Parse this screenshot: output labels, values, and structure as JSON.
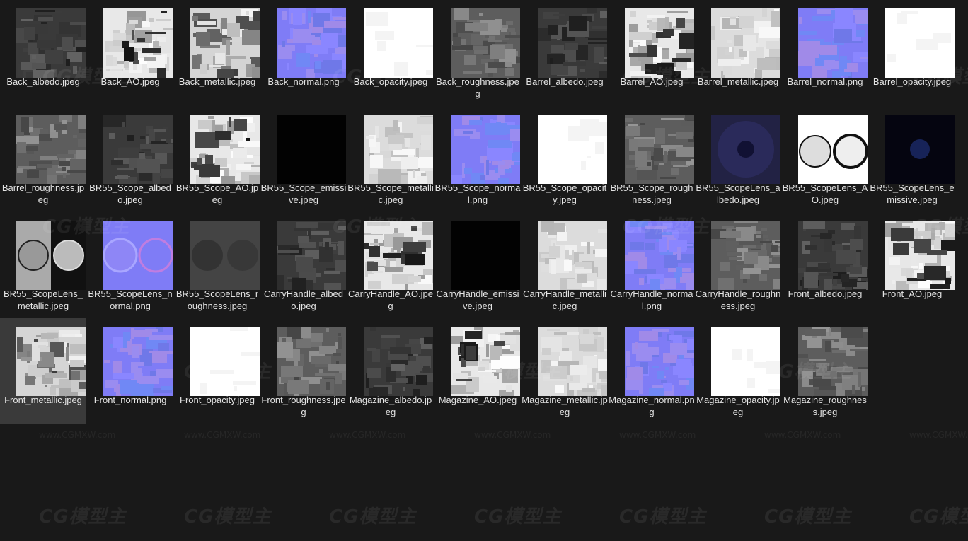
{
  "selected_index": 33,
  "watermark": {
    "logo": "CG模型主",
    "url": "www.CGMXW.com"
  },
  "files": [
    {
      "name": "Back_albedo.jpeg",
      "kind": "dark"
    },
    {
      "name": "Back_AO.jpeg",
      "kind": "ao"
    },
    {
      "name": "Back_metallic.jpeg",
      "kind": "metal"
    },
    {
      "name": "Back_normal.png",
      "kind": "normal"
    },
    {
      "name": "Back_opacity.jpeg",
      "kind": "white"
    },
    {
      "name": "Back_roughness.jpeg",
      "kind": "rough"
    },
    {
      "name": "Barrel_albedo.jpeg",
      "kind": "dark"
    },
    {
      "name": "Barrel_AO.jpeg",
      "kind": "ao"
    },
    {
      "name": "Barrel_metallic.jpeg",
      "kind": "light"
    },
    {
      "name": "Barrel_normal.png",
      "kind": "normal"
    },
    {
      "name": "Barrel_opacity.jpeg",
      "kind": "white"
    },
    {
      "name": "Barrel_roughness.jpeg",
      "kind": "rough"
    },
    {
      "name": "BR55_Scope_albedo.jpeg",
      "kind": "dark"
    },
    {
      "name": "BR55_Scope_AO.jpeg",
      "kind": "ao"
    },
    {
      "name": "BR55_Scope_emissive.jpeg",
      "kind": "black"
    },
    {
      "name": "BR55_Scope_metallic.jpeg",
      "kind": "light"
    },
    {
      "name": "BR55_Scope_normal.png",
      "kind": "normal"
    },
    {
      "name": "BR55_Scope_opacity.jpeg",
      "kind": "white"
    },
    {
      "name": "BR55_Scope_roughness.jpeg",
      "kind": "rough"
    },
    {
      "name": "BR55_ScopeLens_albedo.jpeg",
      "kind": "lensdark"
    },
    {
      "name": "BR55_ScopeLens_AO.jpeg",
      "kind": "lensao"
    },
    {
      "name": "BR55_ScopeLens_emissive.jpeg",
      "kind": "lensemit"
    },
    {
      "name": "BR55_ScopeLens_metallic.jpeg",
      "kind": "lensmetal"
    },
    {
      "name": "BR55_ScopeLens_normal.png",
      "kind": "lensnormal"
    },
    {
      "name": "BR55_ScopeLens_roughness.jpeg",
      "kind": "lensrough"
    },
    {
      "name": "CarryHandle_albedo.jpeg",
      "kind": "dark"
    },
    {
      "name": "CarryHandle_AO.jpeg",
      "kind": "ao"
    },
    {
      "name": "CarryHandle_emissive.jpeg",
      "kind": "black"
    },
    {
      "name": "CarryHandle_metallic.jpeg",
      "kind": "light"
    },
    {
      "name": "CarryHandle_normal.png",
      "kind": "normal"
    },
    {
      "name": "CarryHandle_roughness.jpeg",
      "kind": "rough"
    },
    {
      "name": "Front_albedo.jpeg",
      "kind": "dark"
    },
    {
      "name": "Front_AO.jpeg",
      "kind": "ao"
    },
    {
      "name": "Front_metallic.jpeg",
      "kind": "metal"
    },
    {
      "name": "Front_normal.png",
      "kind": "normal"
    },
    {
      "name": "Front_opacity.jpeg",
      "kind": "white"
    },
    {
      "name": "Front_roughness.jpeg",
      "kind": "rough"
    },
    {
      "name": "Magazine_albedo.jpeg",
      "kind": "dark"
    },
    {
      "name": "Magazine_AO.jpeg",
      "kind": "ao"
    },
    {
      "name": "Magazine_metallic.jpeg",
      "kind": "light"
    },
    {
      "name": "Magazine_normal.png",
      "kind": "normal"
    },
    {
      "name": "Magazine_opacity.jpeg",
      "kind": "white"
    },
    {
      "name": "Magazine_roughness.jpeg",
      "kind": "rough"
    }
  ]
}
